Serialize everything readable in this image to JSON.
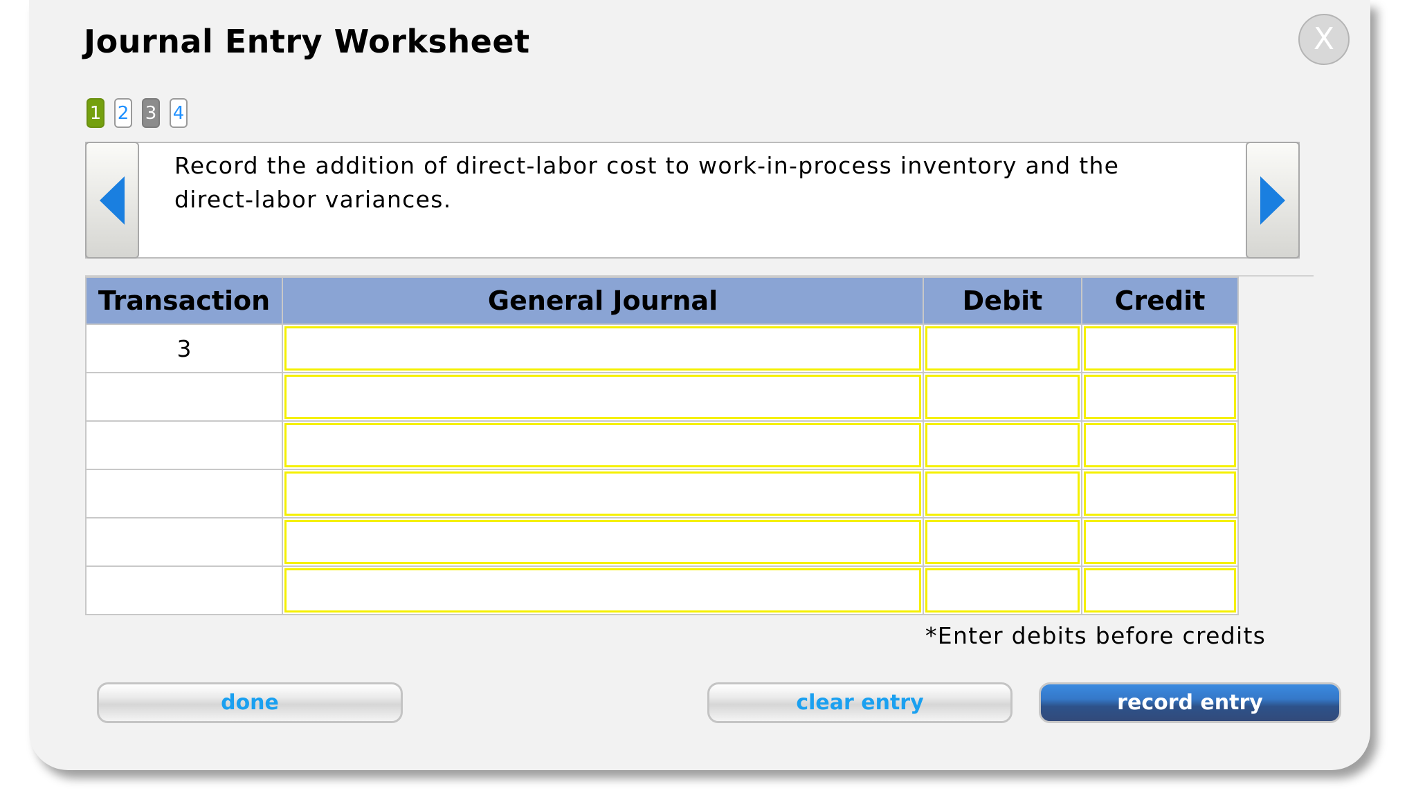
{
  "dialog": {
    "title": "Journal Entry Worksheet",
    "close_label": "X"
  },
  "tabs": [
    {
      "label": "1",
      "state": "active"
    },
    {
      "label": "2",
      "state": "unvisited"
    },
    {
      "label": "3",
      "state": "visited"
    },
    {
      "label": "4",
      "state": "unvisited"
    }
  ],
  "instruction": {
    "text": "Record the addition of direct-labor cost to work-in-process inventory and the direct-labor variances.",
    "prev_icon": "triangle-left-icon",
    "next_icon": "triangle-right-icon"
  },
  "table": {
    "headers": [
      "Transaction",
      "General Journal",
      "Debit",
      "Credit"
    ],
    "rows": [
      {
        "transaction": "3",
        "account": "",
        "debit": "",
        "credit": ""
      },
      {
        "transaction": "",
        "account": "",
        "debit": "",
        "credit": ""
      },
      {
        "transaction": "",
        "account": "",
        "debit": "",
        "credit": ""
      },
      {
        "transaction": "",
        "account": "",
        "debit": "",
        "credit": ""
      },
      {
        "transaction": "",
        "account": "",
        "debit": "",
        "credit": ""
      },
      {
        "transaction": "",
        "account": "",
        "debit": "",
        "credit": ""
      }
    ]
  },
  "note": "*Enter debits before credits",
  "buttons": {
    "done": "done",
    "clear_entry": "clear entry",
    "record_entry": "record entry"
  },
  "colors": {
    "header_bg": "#8aa4d4",
    "input_border": "#f5f000",
    "arrow": "#1a7fe0",
    "tab_active": "#74a00e",
    "tab_visited": "#8c8c8c",
    "link_text": "#1aa0f0",
    "primary_button": "#2d528a"
  }
}
